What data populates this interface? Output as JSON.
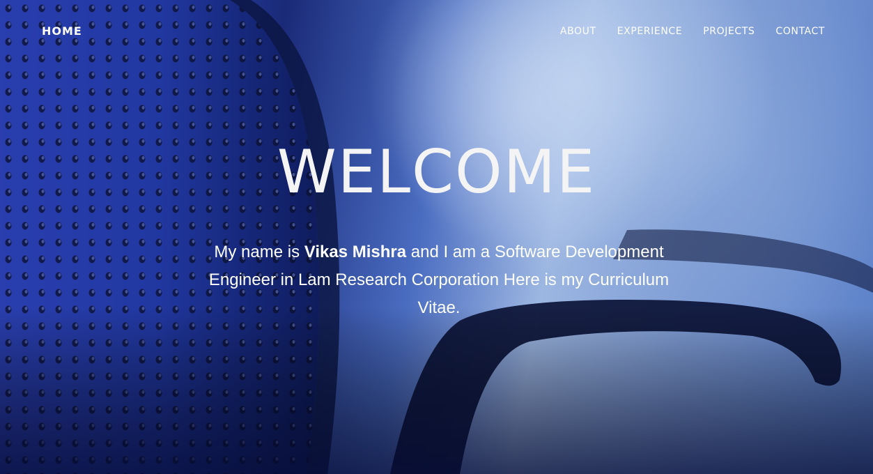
{
  "nav": {
    "home_label": "HOME",
    "links": [
      {
        "label": "ABOUT"
      },
      {
        "label": "EXPERIENCE"
      },
      {
        "label": "PROJECTS"
      },
      {
        "label": "CONTACT"
      }
    ]
  },
  "hero": {
    "heading": "WELCOME",
    "intro_prefix": "My name is ",
    "intro_name": "Vikas Mishra",
    "intro_suffix": " and I am a Software Development Engineer in Lam Research Corporation Here is my Curriculum Vitae."
  },
  "colors": {
    "text": "#ffffff",
    "background_primary": "#2b42a8",
    "background_highlight": "#9db7e2"
  }
}
